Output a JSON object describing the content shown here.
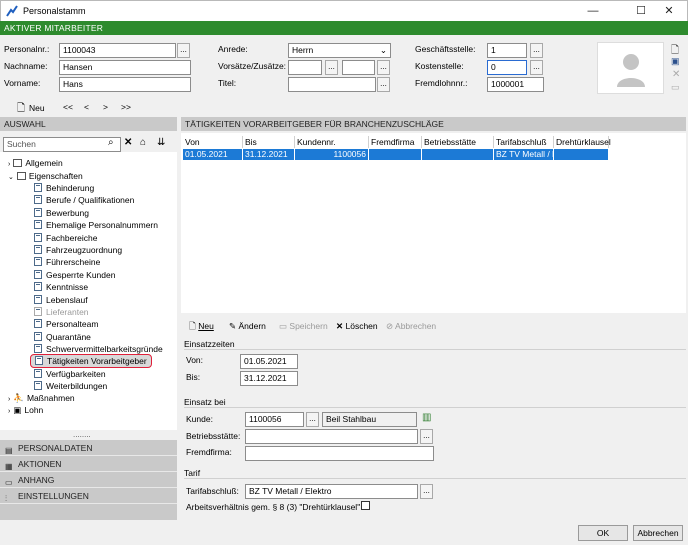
{
  "window": {
    "title": "Personalstamm",
    "minimize": "—",
    "maximize": "☐",
    "close": "✕"
  },
  "header": {
    "banner": "AKTIVER MITARBEITER"
  },
  "form": {
    "personalnr_label": "Personalnr.:",
    "personalnr": "1100043",
    "nachname_label": "Nachname:",
    "nachname": "Hansen",
    "vorname_label": "Vorname:",
    "vorname": "Hans",
    "anrede_label": "Anrede:",
    "anrede": "Herrn",
    "vorsaetze_label": "Vorsätze/Zusätze:",
    "vorsaetze": "",
    "zusaetze": "",
    "titel_label": "Titel:",
    "titel": "",
    "geschaeftsstelle_label": "Geschäftsstelle:",
    "geschaeftsstelle": "1",
    "kostenstelle_label": "Kostenstelle:",
    "kostenstelle": "0",
    "fremdlohnnr_label": "Fremdlohnnr.:",
    "fremdlohnnr": "1000001",
    "dots": "..."
  },
  "toolbar": {
    "neu": "Neu",
    "first": "<<",
    "prev": "<",
    "next": ">",
    "last": ">>"
  },
  "auswahl": {
    "header": "AUSWAHL",
    "search_placeholder": "Suchen",
    "tree": [
      {
        "label": "Allgemein"
      },
      {
        "label": "Eigenschaften"
      },
      {
        "label": "Behinderung"
      },
      {
        "label": "Berufe / Qualifikationen"
      },
      {
        "label": "Bewerbung"
      },
      {
        "label": "Ehemalige Personalnummern"
      },
      {
        "label": "Fachbereiche"
      },
      {
        "label": "Fahrzeugzuordnung"
      },
      {
        "label": "Führerscheine"
      },
      {
        "label": "Gesperrte Kunden"
      },
      {
        "label": "Kenntnisse"
      },
      {
        "label": "Lebenslauf"
      },
      {
        "label": "Lieferanten"
      },
      {
        "label": "Personalteam"
      },
      {
        "label": "Quarantäne"
      },
      {
        "label": "Schwervermittelbarkeitsgründe"
      },
      {
        "label": "Tätigkeiten Vorarbeitgeber"
      },
      {
        "label": "Verfügbarkeiten"
      },
      {
        "label": "Weiterbildungen"
      },
      {
        "label": "Maßnahmen"
      },
      {
        "label": "Lohn"
      }
    ],
    "more": "........",
    "nav": [
      "PERSONALDATEN",
      "AKTIONEN",
      "ANHANG",
      "EINSTELLUNGEN"
    ]
  },
  "panel": {
    "header": "TÄTIGKEITEN VORARBEITGEBER FÜR BRANCHENZUSCHLÄGE",
    "columns": [
      "Von",
      "Bis",
      "Kundennr.",
      "Fremdfirma",
      "Betriebsstätte",
      "Tarifabschluß",
      "Drehtürklausel"
    ],
    "rows": [
      [
        "01.05.2021",
        "31.12.2021",
        "1100056",
        "",
        "",
        "BZ TV Metall / El",
        ""
      ]
    ]
  },
  "actions": {
    "neu": "Neu",
    "aendern": "Ändern",
    "speichern": "Speichern",
    "loeschen": "Löschen",
    "abbrechen": "Abbrechen"
  },
  "einsatzzeiten": {
    "title": "Einsatzzeiten",
    "von_label": "Von:",
    "von": "01.05.2021",
    "bis_label": "Bis:",
    "bis": "31.12.2021"
  },
  "einsatzbei": {
    "title": "Einsatz bei",
    "kunde_label": "Kunde:",
    "kunde_nr": "1100056",
    "kunde_name": "Beil Stahlbau",
    "betriebsstaette_label": "Betriebsstätte:",
    "betriebsstaette": "",
    "fremdfirma_label": "Fremdfirma:",
    "fremdfirma": ""
  },
  "tarif": {
    "title": "Tarif",
    "tarifabschluss_label": "Tarifabschluß:",
    "tarifabschluss": "BZ TV Metall / Elektro",
    "drehtuer_label": "Arbeitsverhältnis gem. § 8 (3) \"Drehtürklausel\":"
  },
  "footer": {
    "ok": "OK",
    "abbrechen": "Abbrechen"
  },
  "colors": {
    "green": "#2e8b2e",
    "select": "#1c7ad6",
    "highlight": "#e0203a"
  }
}
